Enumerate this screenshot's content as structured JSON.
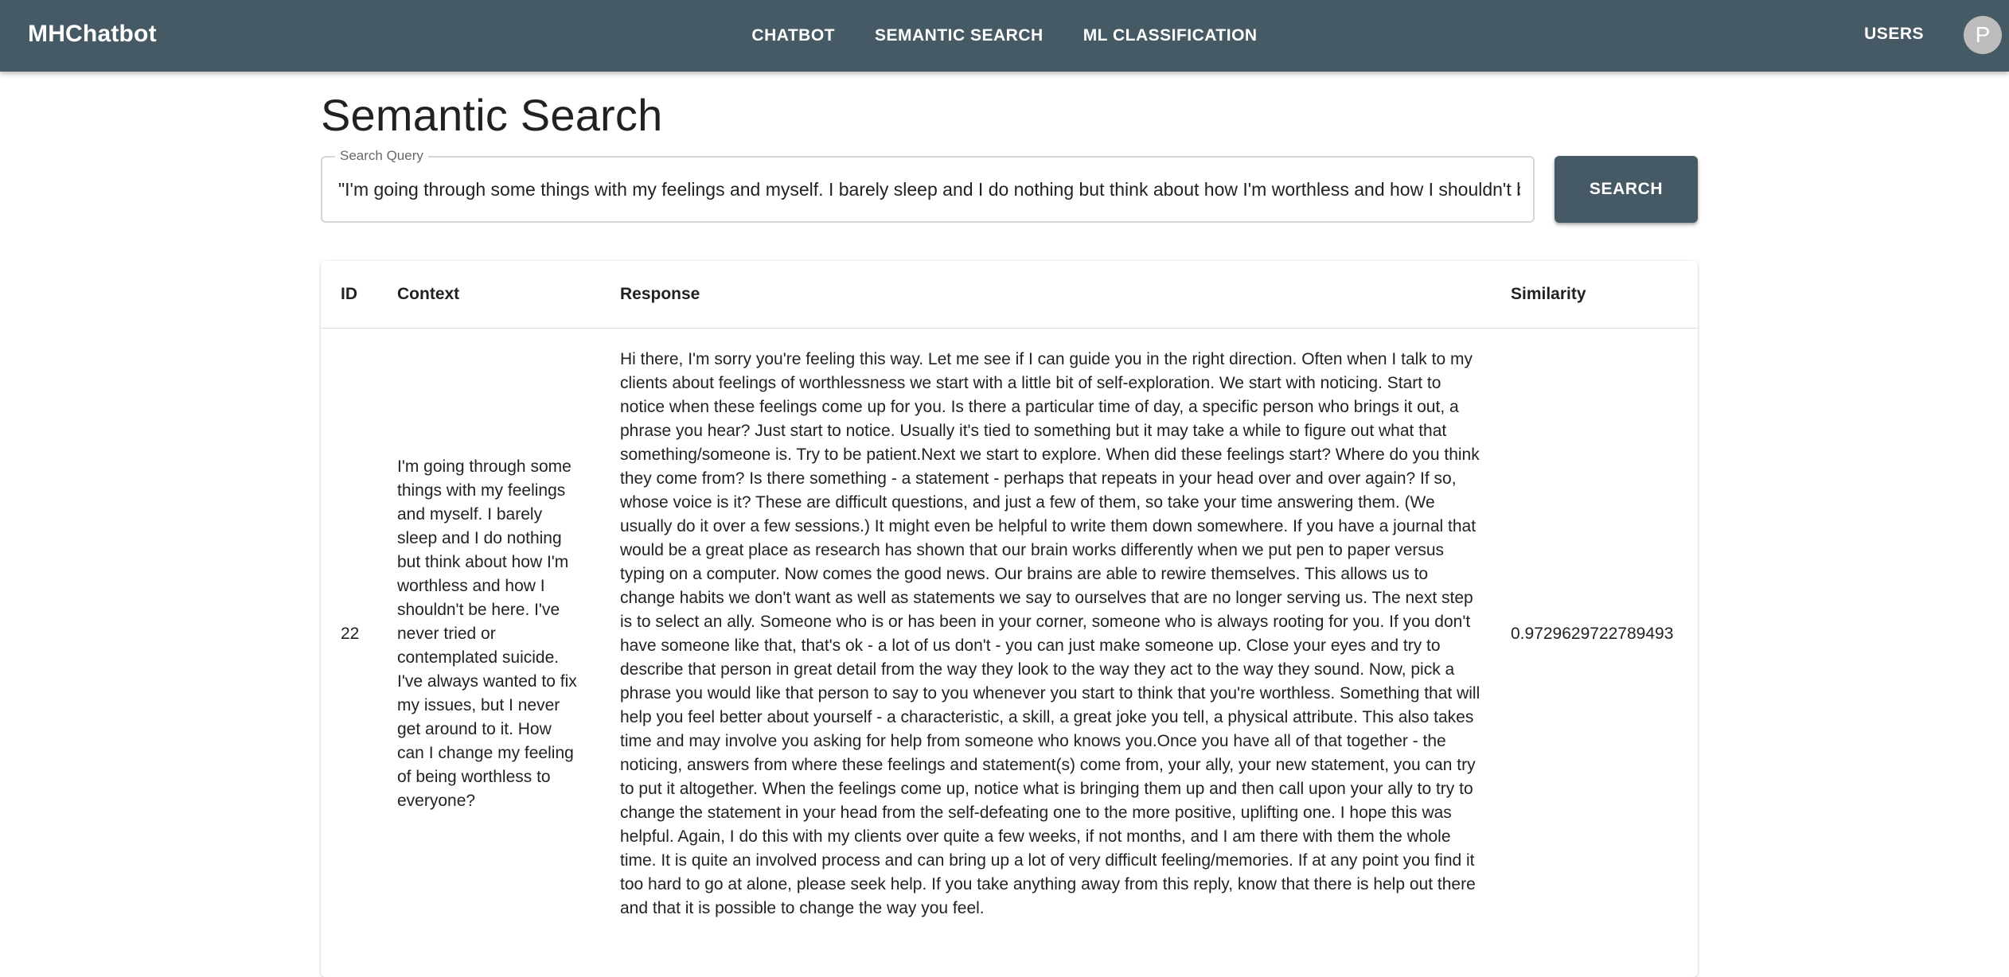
{
  "app": {
    "brand": "MHChatbot",
    "nav": [
      "CHATBOT",
      "SEMANTIC SEARCH",
      "ML CLASSIFICATION"
    ],
    "users_label": "USERS",
    "avatar_initial": "P",
    "bar_color": "#455a64"
  },
  "page": {
    "title": "Semantic Search"
  },
  "search": {
    "label": "Search Query",
    "value": "\"I'm going through some things with my feelings and myself. I barely sleep and I do nothing but think about how I'm worthless and how I shouldn't be here. I've never tried or contemplated suicide. I've always wanted to fix my issues, but I never get around to it. How can I change my feeling of being worthless to everyone?\"",
    "button_label": "SEARCH"
  },
  "table": {
    "headers": [
      "ID",
      "Context",
      "Response",
      "Similarity"
    ],
    "rows": [
      {
        "id": "22",
        "context": "I'm going through some things with my feelings and myself. I barely sleep and I do nothing but think about how I'm worthless and how I shouldn't be here. I've never tried or contemplated suicide. I've always wanted to fix my issues, but I never get around to it. How can I change my feeling of being worthless to everyone?",
        "response": "Hi there, I'm sorry you're feeling this way. Let me see if I can guide you in the right direction. Often when I talk to my clients about feelings of worthlessness we start with a little bit of self-exploration. We start with noticing. Start to notice when these feelings come up for you. Is there a particular time of day, a specific person who brings it out, a phrase you hear? Just start to notice. Usually it's tied to something but it may take a while to figure out what that something/someone is. Try to be patient.Next we start to explore. When did these feelings start? Where do you think they come from? Is there something - a statement - perhaps that repeats in your head over and over again? If so, whose voice is it? These are difficult questions, and just a few of them, so take your time answering them. (We usually do it over a few sessions.) It might even be helpful to write them down somewhere. If you have a journal that would be a great place as research has shown that our brain works differently when we put pen to paper versus typing on a computer. Now comes the good news. Our brains are able to rewire themselves. This allows us to change habits we don't want as well as statements we say to ourselves that are no longer serving us. The next step is to select an ally. Someone who is or has been in your corner, someone who is always rooting for you. If you don't have someone like that, that's ok - a lot of us don't - you can just make someone up. Close your eyes and try to describe that person in great detail from the way they look to the way they act to the way they sound. Now, pick a phrase you would like that person to say to you whenever you start to think that you're worthless. Something that will help you feel better about yourself - a characteristic, a skill, a great joke you tell, a physical attribute. This also takes time and may involve you asking for help from someone who knows you.Once you have all of that together - the noticing, answers from where these feelings and statement(s) come from, your ally, your new statement, you can try to put it altogether. When the feelings come up, notice what is bringing them up and then call upon your ally to try to change the statement in your head from the self-defeating one to the more positive, uplifting one. I hope this was helpful. Again, I do this with my clients over quite a few weeks, if not months, and I am there with them the whole time. It is quite an involved process and can bring up a lot of very difficult feeling/memories. If at any point you find it too hard to go at alone, please seek help. If you take anything away from this reply, know that there is help out there and that it is possible to change the way you feel.",
        "similarity": "0.9729629722789493"
      }
    ]
  }
}
